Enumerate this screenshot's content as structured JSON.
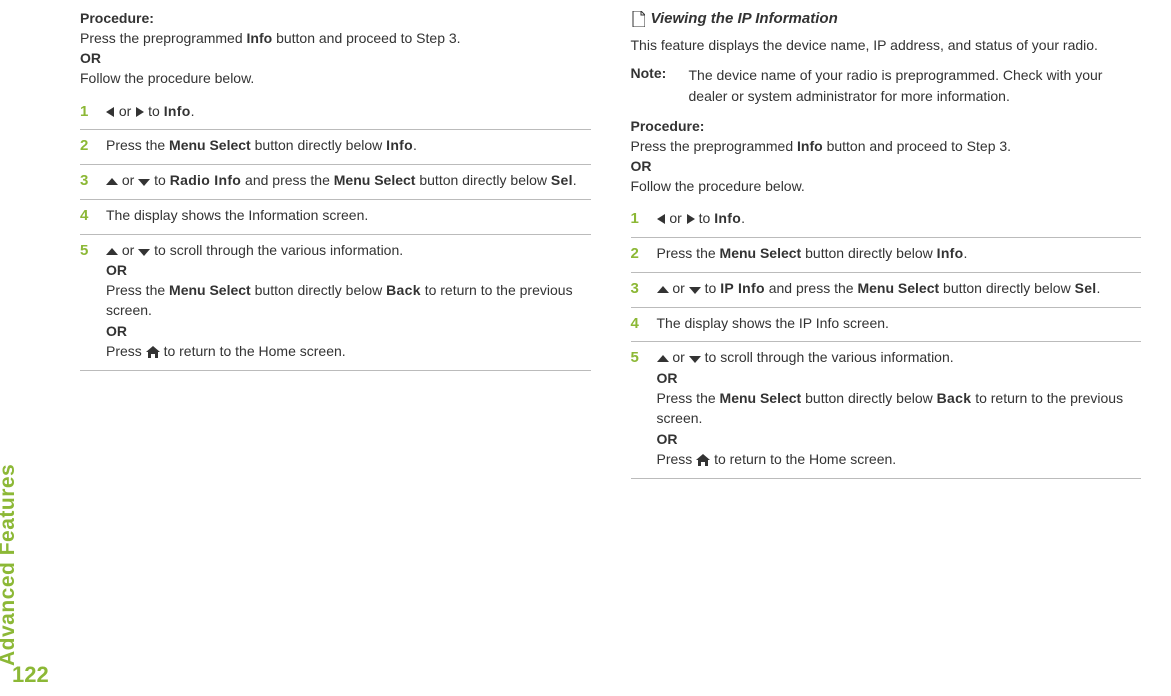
{
  "sidebar": {
    "section_title": "Advanced Features",
    "page_number": "122"
  },
  "left": {
    "procedure_label": "Procedure:",
    "proc_intro_1a": "Press the preprogrammed ",
    "proc_intro_1b": "Info",
    "proc_intro_1c": " button and proceed to Step 3.",
    "or": "OR",
    "proc_intro_2": "Follow the procedure below.",
    "steps": [
      {
        "num": "1",
        "parts": {
          "a": " or ",
          "b": " to ",
          "target": "Info",
          "end": "."
        }
      },
      {
        "num": "2",
        "parts": {
          "a": "Press the ",
          "b": "Menu Select",
          "c": " button directly below ",
          "target": "Info",
          "end": "."
        }
      },
      {
        "num": "3",
        "parts": {
          "a": " or ",
          "b": " to ",
          "target": "Radio Info",
          "c": " and press the ",
          "d": "Menu Select",
          "e": " button directly below ",
          "target2": "Sel",
          "end": "."
        }
      },
      {
        "num": "4",
        "parts": {
          "text": "The display shows the Information screen."
        }
      },
      {
        "num": "5",
        "parts": {
          "a": " or ",
          "b": " to scroll through the various information.",
          "or1": "OR",
          "c": "Press the ",
          "d": "Menu Select",
          "e": " button directly below ",
          "target": "Back",
          "f": " to return to the previous screen.",
          "or2": "OR",
          "g": "Press ",
          "h": " to return to the Home screen."
        }
      }
    ]
  },
  "right": {
    "heading": "Viewing the IP Information",
    "intro": "This feature displays the device name, IP address, and status of your radio.",
    "note_label": "Note:",
    "note_text": "The device name of your radio is preprogrammed. Check with your dealer or system administrator for more information.",
    "procedure_label": "Procedure:",
    "proc_intro_1a": "Press the preprogrammed ",
    "proc_intro_1b": "Info",
    "proc_intro_1c": " button and proceed to Step 3.",
    "or": "OR",
    "proc_intro_2": "Follow the procedure below.",
    "steps": [
      {
        "num": "1",
        "parts": {
          "a": " or ",
          "b": " to ",
          "target": "Info",
          "end": "."
        }
      },
      {
        "num": "2",
        "parts": {
          "a": "Press the ",
          "b": "Menu Select",
          "c": " button directly below ",
          "target": "Info",
          "end": "."
        }
      },
      {
        "num": "3",
        "parts": {
          "a": " or ",
          "b": " to ",
          "target": "IP Info",
          "c": " and press the ",
          "d": "Menu Select",
          "e": " button directly below ",
          "target2": "Sel",
          "end": "."
        }
      },
      {
        "num": "4",
        "parts": {
          "text": "The display shows the IP Info screen."
        }
      },
      {
        "num": "5",
        "parts": {
          "a": " or ",
          "b": " to scroll through the various information.",
          "or1": "OR",
          "c": "Press the ",
          "d": "Menu Select",
          "e": " button directly below ",
          "target": "Back",
          "f": " to return to the previous screen.",
          "or2": "OR",
          "g": "Press ",
          "h": " to return to the Home screen."
        }
      }
    ]
  }
}
